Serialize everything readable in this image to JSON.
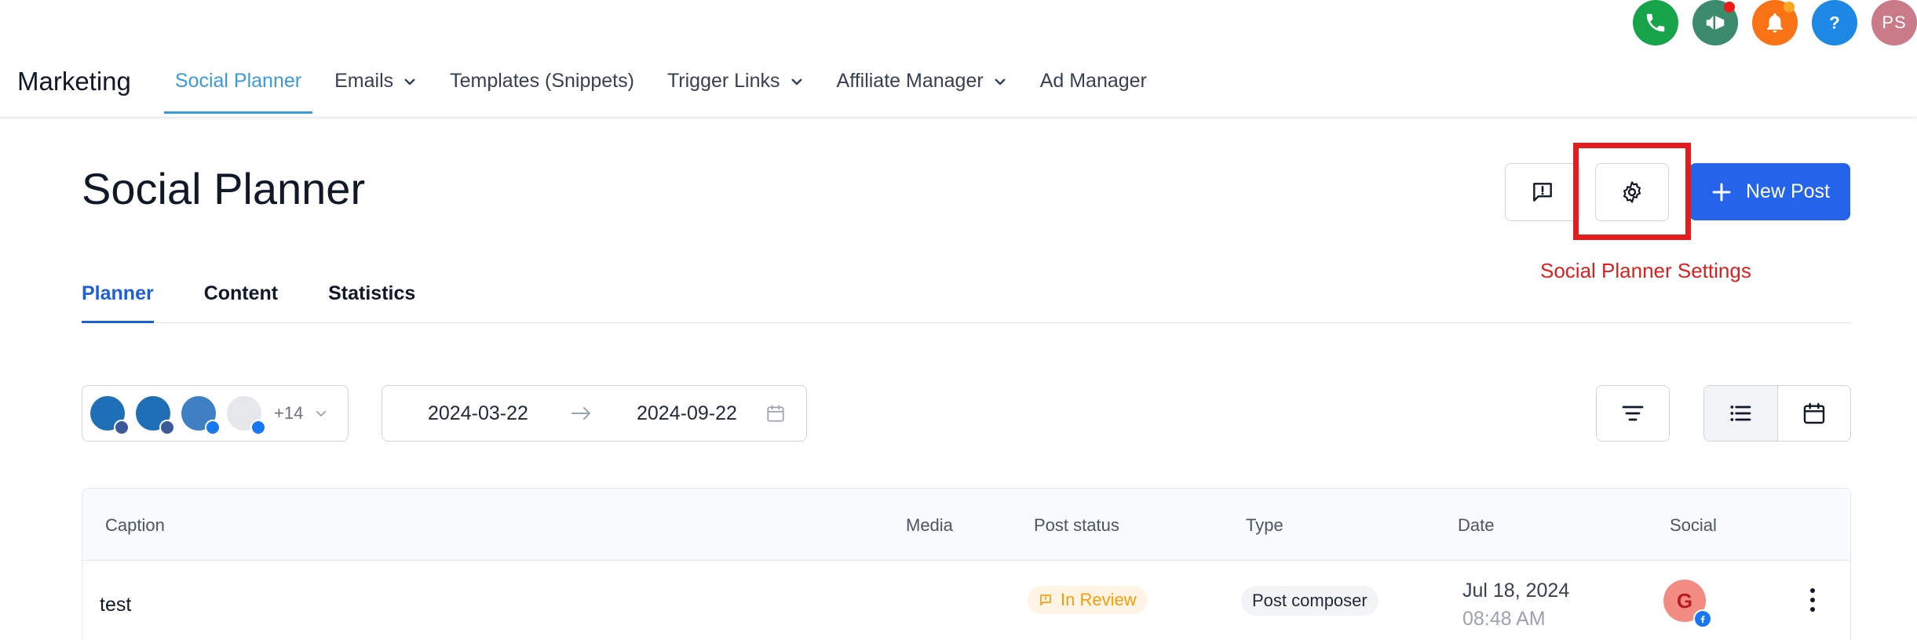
{
  "colors": {
    "accent_blue": "#2563eb",
    "nav_active": "#3b9ad9",
    "tab_active": "#1d5fd6",
    "annotation_red": "#e11d1d",
    "phone_green": "#16a34a",
    "megaphone_teal": "#2f855a",
    "bell_orange": "#f97316",
    "help_blue": "#1e88e5",
    "avatar_pink": "#c97b8a",
    "review_orange": "#f59e0b"
  },
  "top_icons": [
    {
      "icon": "phone-icon",
      "color": "#16a34a"
    },
    {
      "icon": "megaphone-icon",
      "color": "#3c8b6c",
      "dot": "#ef1a1a"
    },
    {
      "icon": "bell-icon",
      "color": "#f97316",
      "dot": "#f6a623"
    },
    {
      "icon": "help-icon",
      "color": "#1e88e5"
    }
  ],
  "user": {
    "initials": "PS"
  },
  "header": {
    "brand": "Marketing",
    "nav": [
      {
        "label": "Social Planner",
        "active": true
      },
      {
        "label": "Emails",
        "dropdown": true
      },
      {
        "label": "Templates (Snippets)"
      },
      {
        "label": "Trigger Links",
        "dropdown": true
      },
      {
        "label": "Affiliate Manager",
        "dropdown": true
      },
      {
        "label": "Ad Manager"
      }
    ]
  },
  "page": {
    "title": "Social Planner",
    "new_post_label": "New Post",
    "annotation": "Social Planner Settings"
  },
  "tabs": [
    {
      "label": "Planner",
      "active": true
    },
    {
      "label": "Content"
    },
    {
      "label": "Statistics"
    }
  ],
  "filters": {
    "accounts_more": "+14",
    "date_start": "2024-03-22",
    "date_end": "2024-09-22"
  },
  "table": {
    "columns": [
      "Caption",
      "Media",
      "Post status",
      "Type",
      "Date",
      "Social"
    ],
    "rows": [
      {
        "caption": "test",
        "status": "In Review",
        "type": "Post composer",
        "date": "Jul 18, 2024",
        "time": "08:48 AM",
        "social_initial": "G"
      }
    ]
  }
}
